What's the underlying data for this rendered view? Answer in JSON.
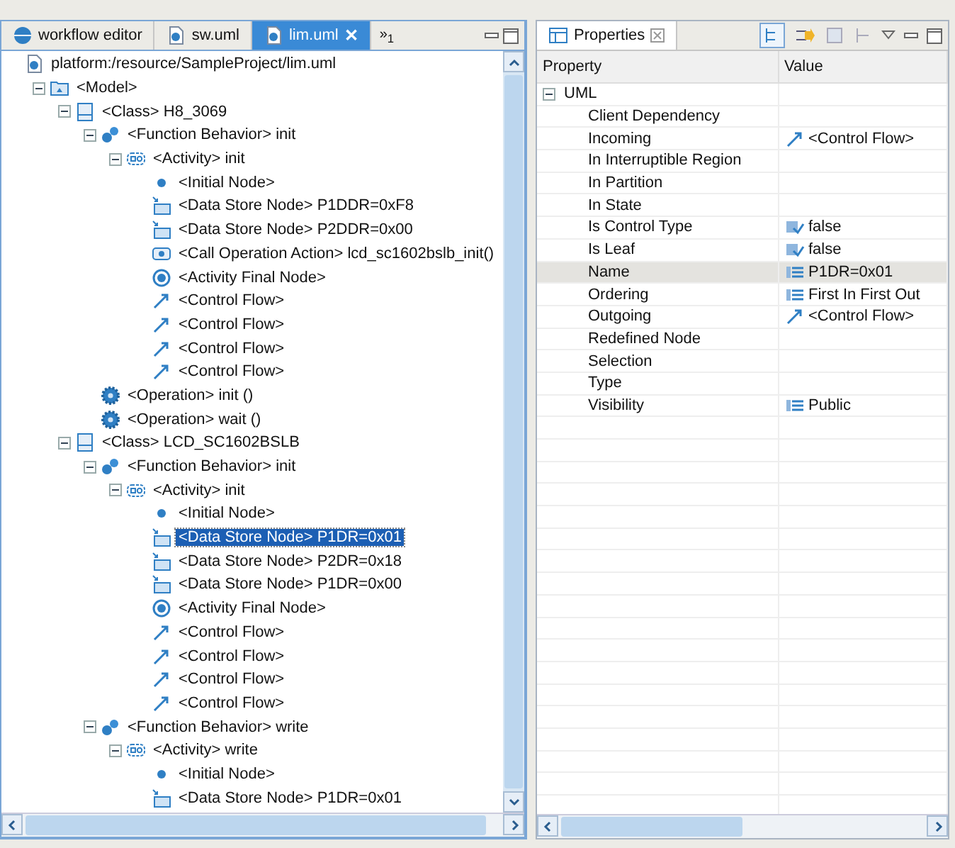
{
  "editor": {
    "tabs": [
      {
        "label": "workflow editor",
        "kind": "globe",
        "selected": false
      },
      {
        "label": "sw.uml",
        "kind": "file",
        "selected": false
      },
      {
        "label": "lim.uml",
        "kind": "file",
        "selected": true,
        "close": "✕"
      }
    ],
    "overflow": "»$_{1}$",
    "tree": [
      {
        "label": "platform:/resource/SampleProject/lim.uml",
        "kind": "resource",
        "selected": false,
        "children": [
          {
            "label": "<Model>",
            "kind": "model",
            "expanded": true,
            "selected": false,
            "children": [
              {
                "label": "<Class> H8_3069",
                "kind": "class",
                "expanded": true,
                "selected": false,
                "children": [
                  {
                    "label": "<Function Behavior> init",
                    "kind": "behavior",
                    "expanded": true,
                    "selected": false,
                    "children": [
                      {
                        "label": "<Activity> init",
                        "kind": "activity",
                        "expanded": true,
                        "selected": false,
                        "children": [
                          {
                            "label": "<Initial Node>",
                            "kind": "initial",
                            "selected": false
                          },
                          {
                            "label": "<Data Store Node> P1DDR=0xF8",
                            "kind": "datastore",
                            "selected": false
                          },
                          {
                            "label": "<Data Store Node> P2DDR=0x00",
                            "kind": "datastore",
                            "selected": false
                          },
                          {
                            "label": "<Call Operation Action> lcd_sc1602bslb_init()",
                            "kind": "call",
                            "selected": false
                          },
                          {
                            "label": "<Activity Final Node>",
                            "kind": "final",
                            "selected": false
                          },
                          {
                            "label": "<Control Flow>",
                            "kind": "flow",
                            "selected": false
                          },
                          {
                            "label": "<Control Flow>",
                            "kind": "flow",
                            "selected": false
                          },
                          {
                            "label": "<Control Flow>",
                            "kind": "flow",
                            "selected": false
                          },
                          {
                            "label": "<Control Flow>",
                            "kind": "flow",
                            "selected": false
                          }
                        ]
                      }
                    ]
                  },
                  {
                    "label": "<Operation> init ()",
                    "kind": "operation",
                    "selected": false
                  },
                  {
                    "label": "<Operation> wait ()",
                    "kind": "operation",
                    "selected": false
                  }
                ]
              },
              {
                "label": "<Class> LCD_SC1602BSLB",
                "kind": "class",
                "expanded": true,
                "selected": false,
                "children": [
                  {
                    "label": "<Function Behavior> init",
                    "kind": "behavior",
                    "expanded": true,
                    "selected": false,
                    "children": [
                      {
                        "label": "<Activity> init",
                        "kind": "activity",
                        "expanded": true,
                        "selected": false,
                        "children": [
                          {
                            "label": "<Initial Node>",
                            "kind": "initial",
                            "selected": false
                          },
                          {
                            "label": "<Data Store Node> P1DR=0x01",
                            "kind": "datastore",
                            "selected": true
                          },
                          {
                            "label": "<Data Store Node> P2DR=0x18",
                            "kind": "datastore",
                            "selected": false
                          },
                          {
                            "label": "<Data Store Node> P1DR=0x00",
                            "kind": "datastore",
                            "selected": false
                          },
                          {
                            "label": "<Activity Final Node>",
                            "kind": "final",
                            "selected": false
                          },
                          {
                            "label": "<Control Flow>",
                            "kind": "flow",
                            "selected": false
                          },
                          {
                            "label": "<Control Flow>",
                            "kind": "flow",
                            "selected": false
                          },
                          {
                            "label": "<Control Flow>",
                            "kind": "flow",
                            "selected": false
                          },
                          {
                            "label": "<Control Flow>",
                            "kind": "flow",
                            "selected": false
                          }
                        ]
                      }
                    ]
                  },
                  {
                    "label": "<Function Behavior> write",
                    "kind": "behavior",
                    "expanded": true,
                    "selected": false,
                    "children": [
                      {
                        "label": "<Activity> write",
                        "kind": "activity",
                        "expanded": true,
                        "selected": false,
                        "children": [
                          {
                            "label": "<Initial Node>",
                            "kind": "initial",
                            "selected": false
                          },
                          {
                            "label": "<Data Store Node> P1DR=0x01",
                            "kind": "datastore",
                            "selected": false
                          }
                        ]
                      }
                    ]
                  }
                ]
              }
            ]
          }
        ]
      }
    ]
  },
  "properties": {
    "title": "Properties",
    "columns": [
      "Property",
      "Value"
    ],
    "group": {
      "label": "UML",
      "expanded": true
    },
    "rows": [
      {
        "property": "Client Dependency",
        "selected": false
      },
      {
        "property": "Incoming",
        "value": "<Control Flow>",
        "kind": "flow",
        "selected": false
      },
      {
        "property": "In Interruptible Region",
        "selected": false
      },
      {
        "property": "In Partition",
        "selected": false
      },
      {
        "property": "In State",
        "selected": false
      },
      {
        "property": "Is Control Type",
        "value": "false",
        "kind": "bool",
        "selected": false
      },
      {
        "property": "Is Leaf",
        "value": "false",
        "kind": "bool",
        "selected": false
      },
      {
        "property": "Name",
        "value": "P1DR=0x01",
        "kind": "text",
        "selected": true
      },
      {
        "property": "Ordering",
        "value": "First In First Out",
        "kind": "text",
        "selected": false
      },
      {
        "property": "Outgoing",
        "value": "<Control Flow>",
        "kind": "flow",
        "selected": false
      },
      {
        "property": "Redefined Node",
        "selected": false
      },
      {
        "property": "Selection",
        "selected": false
      },
      {
        "property": "Type",
        "selected": false
      },
      {
        "property": "Visibility",
        "value": "Public",
        "kind": "text",
        "selected": false
      }
    ]
  }
}
